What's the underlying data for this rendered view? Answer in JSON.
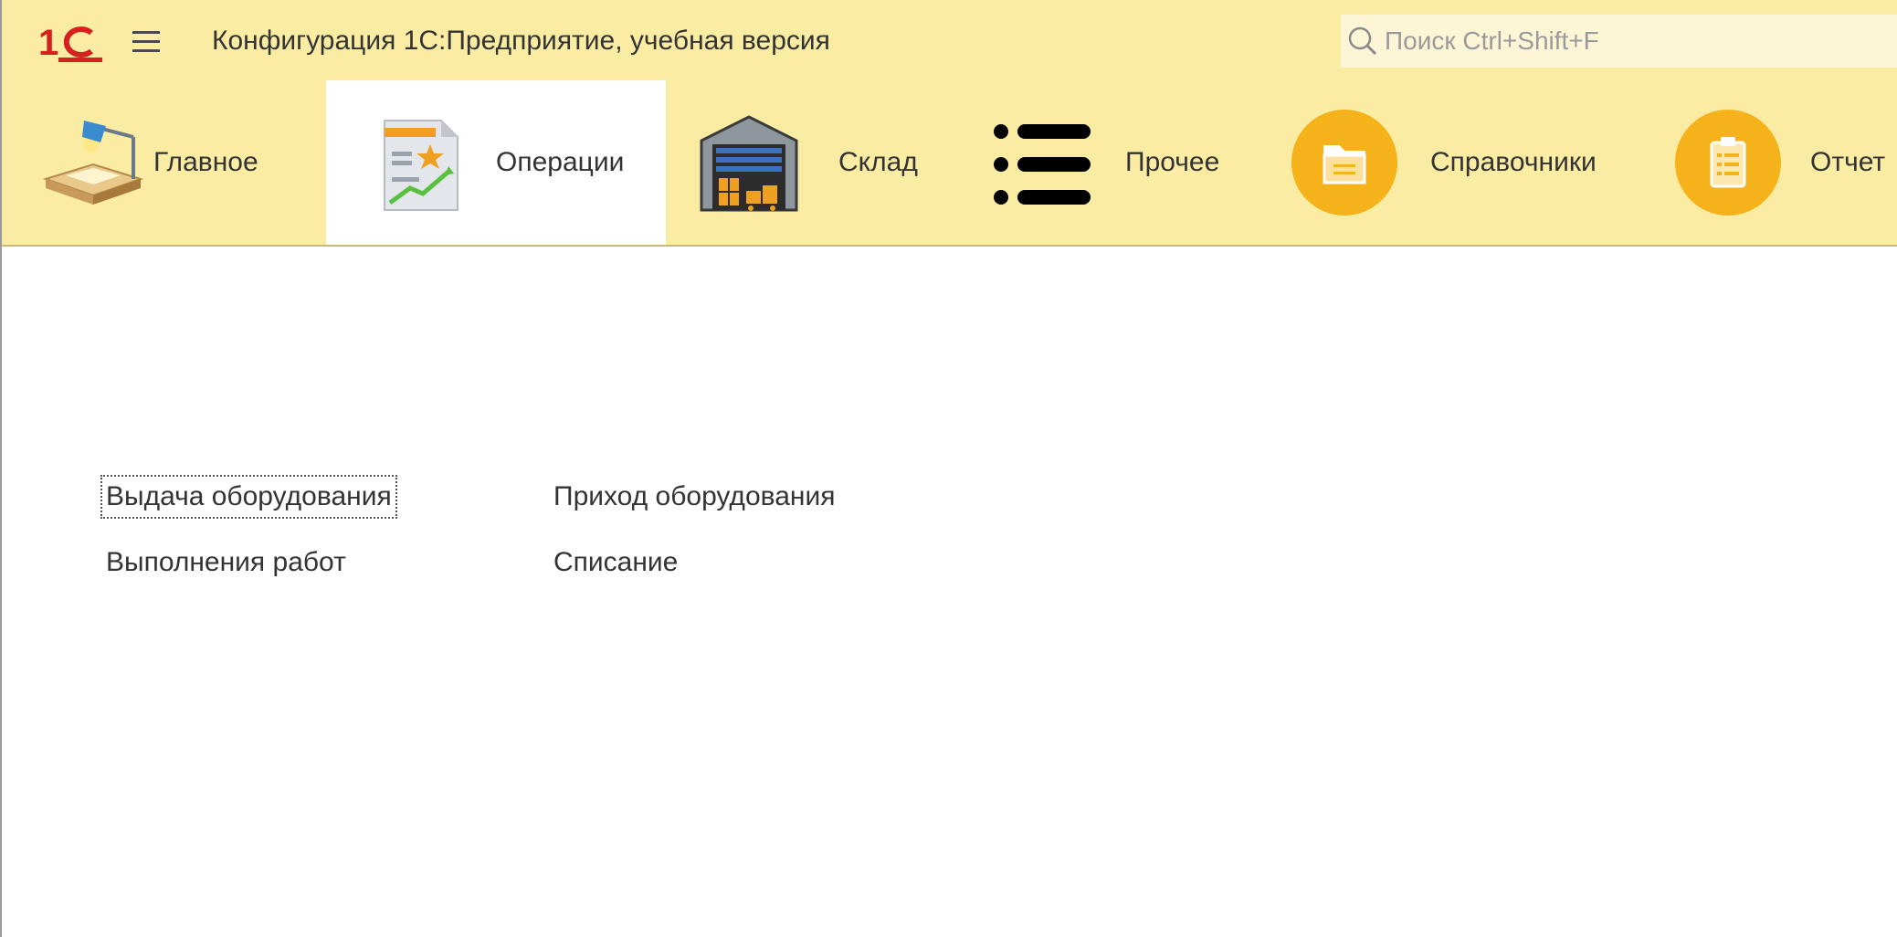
{
  "titlebar": {
    "logo_icon": "1c-logo-icon",
    "menu_icon": "hamburger-menu-icon",
    "title": "Конфигурация 1С:Предприятие, учебная версия",
    "search_placeholder": "Поиск Ctrl+Shift+F"
  },
  "sections": [
    {
      "label": "Главное",
      "icon": "desk-lamp-icon",
      "active": false
    },
    {
      "label": "Операции",
      "icon": "document-chart-icon",
      "active": true
    },
    {
      "label": "Склад",
      "icon": "warehouse-icon",
      "active": false
    },
    {
      "label": "Прочее",
      "icon": "list-icon",
      "active": false
    },
    {
      "label": "Справочники",
      "icon": "folder-icon",
      "active": false
    },
    {
      "label": "Отчет",
      "icon": "clipboard-icon",
      "active": false
    }
  ],
  "content": {
    "commands": [
      {
        "label": "Выдача оборудования",
        "focused": true
      },
      {
        "label": "Приход оборудования",
        "focused": false
      },
      {
        "label": "Выполнения работ",
        "focused": false
      },
      {
        "label": "Списание",
        "focused": false
      }
    ]
  },
  "colors": {
    "panel_bg": "#fbeca4",
    "accent_orange": "#f5b21a",
    "logo_red": "#d6201d"
  }
}
